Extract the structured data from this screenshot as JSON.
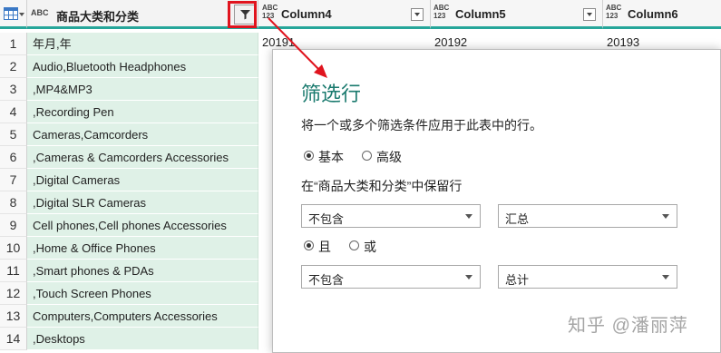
{
  "columns": {
    "c1": {
      "type": "ABC",
      "label": "商品大类和分类"
    },
    "c4": {
      "type_top": "ABC",
      "type_bottom": "123",
      "label": "Column4"
    },
    "c5": {
      "type_top": "ABC",
      "type_bottom": "123",
      "label": "Column5"
    },
    "c6": {
      "type_top": "ABC",
      "type_bottom": "123",
      "label": "Column6"
    }
  },
  "rows": [
    {
      "n": "1",
      "c1": "年月,年",
      "c4": "20191",
      "c5": "20192",
      "c6": "20193"
    },
    {
      "n": "2",
      "c1": "Audio,Bluetooth Headphones"
    },
    {
      "n": "3",
      "c1": ",MP4&MP3"
    },
    {
      "n": "4",
      "c1": ",Recording Pen"
    },
    {
      "n": "5",
      "c1": "Cameras,Camcorders"
    },
    {
      "n": "6",
      "c1": ",Cameras & Camcorders Accessories"
    },
    {
      "n": "7",
      "c1": ",Digital Cameras"
    },
    {
      "n": "8",
      "c1": ",Digital SLR Cameras"
    },
    {
      "n": "9",
      "c1": "Cell phones,Cell phones Accessories"
    },
    {
      "n": "10",
      "c1": ",Home & Office Phones"
    },
    {
      "n": "11",
      "c1": ",Smart phones & PDAs"
    },
    {
      "n": "12",
      "c1": ",Touch Screen Phones"
    },
    {
      "n": "13",
      "c1": "Computers,Computers Accessories"
    },
    {
      "n": "14",
      "c1": ",Desktops"
    }
  ],
  "dialog": {
    "title": "筛选行",
    "description": "将一个或多个筛选条件应用于此表中的行。",
    "mode_basic": "基本",
    "mode_advanced": "高级",
    "keep_rows_label": "在“商品大类和分类”中保留行",
    "cond1_operator": "不包含",
    "cond1_value": "汇总",
    "and_label": "且",
    "or_label": "或",
    "cond2_operator": "不包含",
    "cond2_value": "总计"
  },
  "watermark": {
    "brand": "知乎",
    "author": "@潘丽萍"
  },
  "colors": {
    "accent": "#26a69a",
    "highlight": "#e0141e",
    "column_fill": "#dff1e7",
    "title": "#1a7a6e"
  }
}
